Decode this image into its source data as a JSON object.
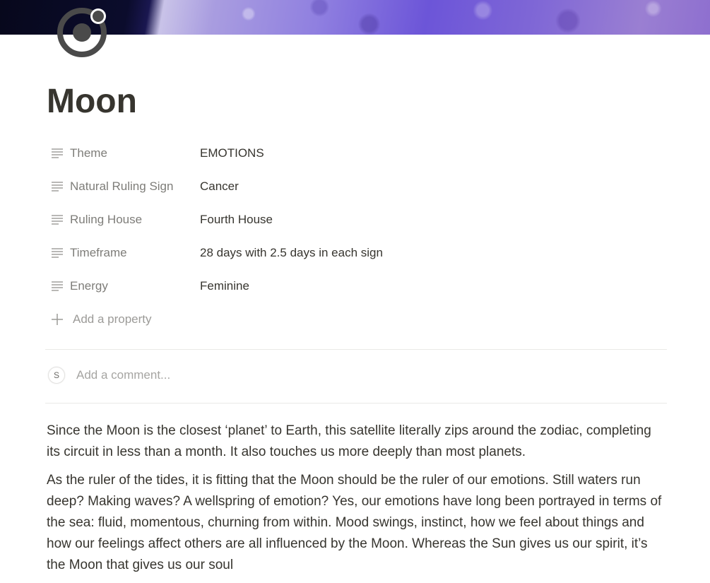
{
  "page": {
    "title": "Moon",
    "icon": "ionic-logo-icon"
  },
  "properties": [
    {
      "key": "Theme",
      "value": "EMOTIONS",
      "icon": "text-lines-icon"
    },
    {
      "key": "Natural Ruling Sign",
      "value": "Cancer",
      "icon": "text-lines-icon"
    },
    {
      "key": "Ruling House",
      "value": "Fourth House",
      "icon": "text-lines-icon"
    },
    {
      "key": "Timeframe",
      "value": "28 days with 2.5 days in each sign",
      "icon": "text-lines-icon"
    },
    {
      "key": "Energy",
      "value": "Feminine",
      "icon": "text-lines-icon"
    }
  ],
  "add_property_label": "Add a property",
  "comment": {
    "avatar_initial": "S",
    "placeholder": "Add a comment..."
  },
  "body": [
    "Since the Moon is the closest ‘planet’ to Earth, this satellite literally zips around the zodiac, completing its circuit in less than a month. It also touches us more deeply than most planets.",
    "As the ruler of the tides, it is fitting that the Moon should be the ruler of our emotions. Still waters run deep? Making waves? A wellspring of emotion? Yes, our emotions have long been portrayed in terms of the sea: fluid, momentous, churning from within. Mood swings, instinct, how we feel about things and how our feelings affect others are all influenced by the Moon. Whereas the Sun gives us our spirit, it’s the Moon that gives us our soul"
  ],
  "colors": {
    "text": "#37352f",
    "muted": "#9b9a97",
    "divider": "#e9e9e7"
  }
}
